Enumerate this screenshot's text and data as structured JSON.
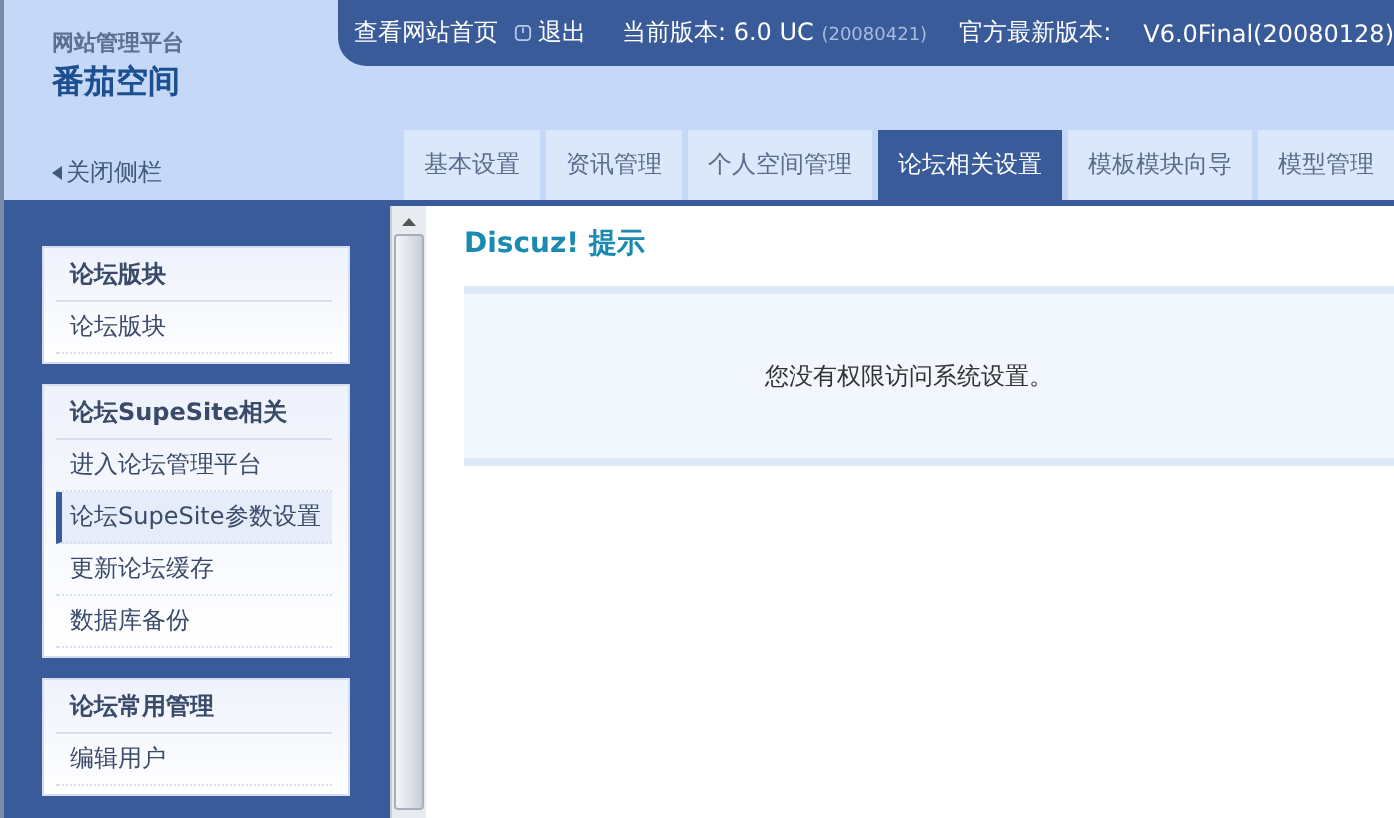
{
  "brand": {
    "subtitle": "网站管理平台",
    "title": "番茄空间"
  },
  "top_links": [
    {
      "kind": "link",
      "label": "查看网站首页"
    },
    {
      "kind": "logout",
      "label": "退出"
    }
  ],
  "version": {
    "label": "当前版本:",
    "value": "6.0 UC",
    "date": "(20080421)"
  },
  "latest": {
    "label": "官方最新版本:",
    "value": "V6.0Final(20080128)"
  },
  "sidebar_toggle": "关闭侧栏",
  "tabs": [
    {
      "label": "基本设置",
      "selected": false
    },
    {
      "label": "资讯管理",
      "selected": false
    },
    {
      "label": "个人空间管理",
      "selected": false
    },
    {
      "label": "论坛相关设置",
      "selected": true
    },
    {
      "label": "模板模块向导",
      "selected": false
    },
    {
      "label": "模型管理",
      "selected": false
    }
  ],
  "sidebar": [
    {
      "title": "论坛版块",
      "items": [
        {
          "label": "论坛版块",
          "selected": false
        }
      ]
    },
    {
      "title": "论坛SupeSite相关",
      "items": [
        {
          "label": "进入论坛管理平台",
          "selected": false
        },
        {
          "label": "论坛SupeSite参数设置",
          "selected": true
        },
        {
          "label": "更新论坛缓存",
          "selected": false
        },
        {
          "label": "数据库备份",
          "selected": false
        }
      ]
    },
    {
      "title": "论坛常用管理",
      "items": [
        {
          "label": "编辑用户",
          "selected": false
        }
      ]
    }
  ],
  "notice": {
    "title": "Discuz! 提示",
    "message": "您没有权限访问系统设置。"
  }
}
